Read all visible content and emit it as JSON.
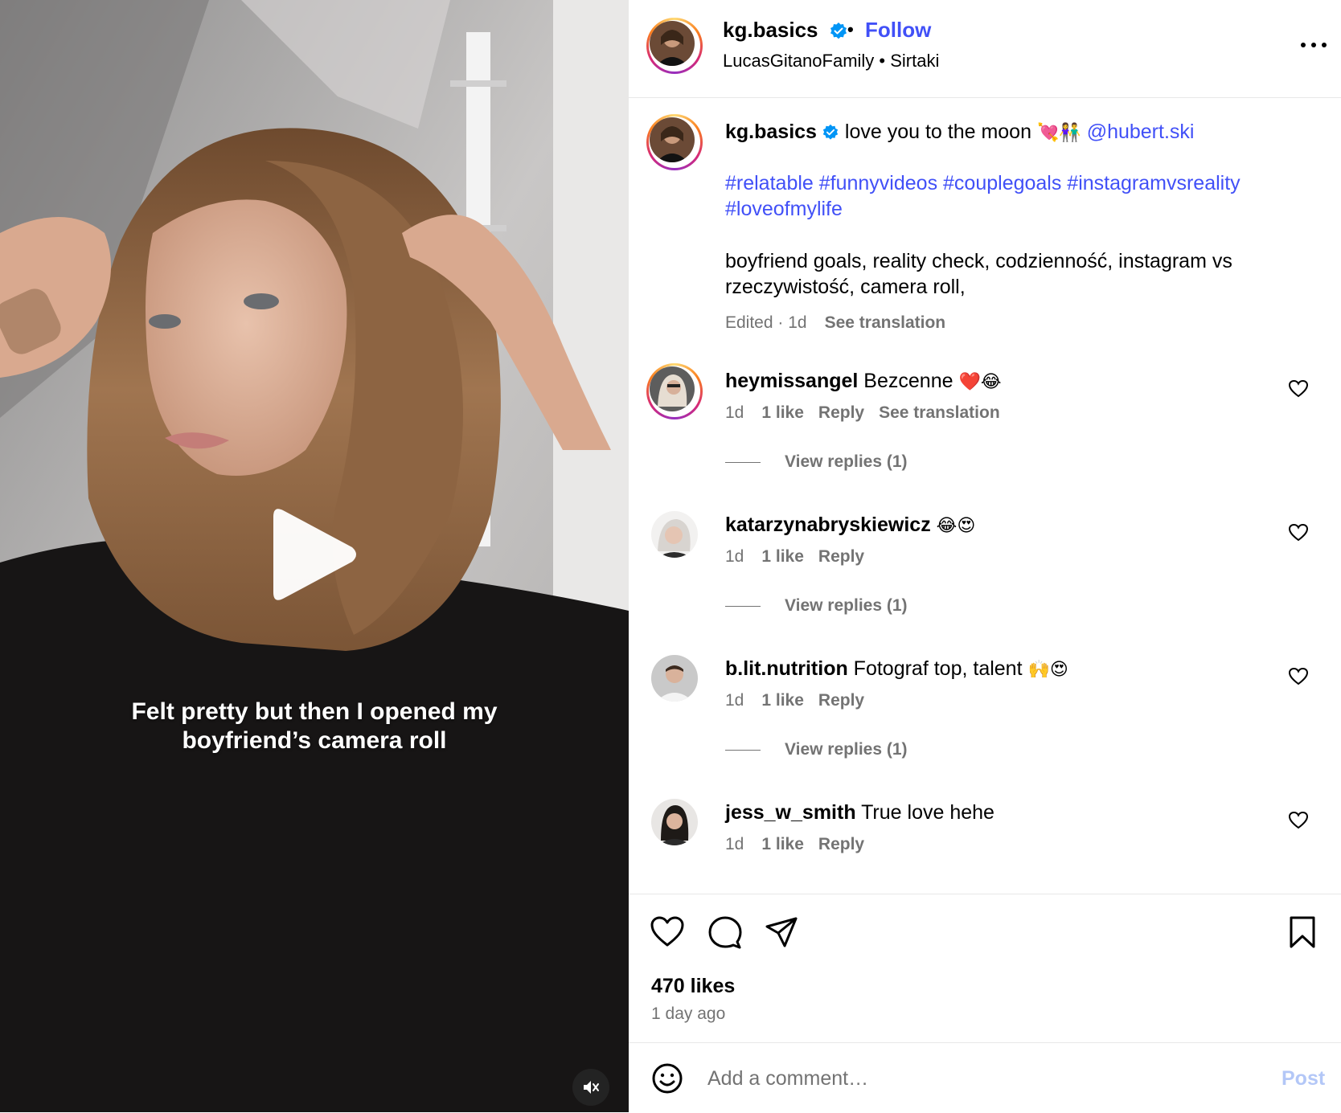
{
  "video": {
    "overlay_line1": "Felt pretty but then I opened my",
    "overlay_line2": "boyfriend’s camera roll",
    "play_icon": "play-icon",
    "mute_icon": "speaker-muted-icon"
  },
  "header": {
    "username": "kg.basics",
    "separator": "•",
    "follow_label": "Follow",
    "subtitle": "LucasGitanoFamily • Sirtaki",
    "more_icon": "more-horizontal-icon"
  },
  "caption": {
    "username": "kg.basics",
    "text": " love you to the moon ",
    "emoji": "💘👫",
    "mention": "@hubert.ski",
    "hashtags_line1": "#relatable #funnyvideos #couplegoals #instagramvsreality",
    "hashtags_line2": "#loveofmylife",
    "keywords": "boyfriend goals, reality check, codzienność, instagram vs rzeczywistość, camera roll,",
    "edited": "Edited · 1d",
    "see_translation": "See translation"
  },
  "comments": [
    {
      "username": "heymissangel",
      "text": " Bezcenne ",
      "emoji": "❤️😂",
      "time": "1d",
      "likes": "1 like",
      "reply": "Reply",
      "translate": "See translation",
      "view_replies": "View replies (1)"
    },
    {
      "username": "katarzynabryskiewicz",
      "text": " ",
      "emoji": "😂😍",
      "time": "1d",
      "likes": "1 like",
      "reply": "Reply",
      "view_replies": "View replies (1)"
    },
    {
      "username": "b.lit.nutrition",
      "text": " Fotograf top, talent ",
      "emoji": "🙌😍",
      "time": "1d",
      "likes": "1 like",
      "reply": "Reply",
      "view_replies": "View replies (1)"
    },
    {
      "username": "jess_w_smith",
      "text": " True love hehe",
      "emoji": "",
      "time": "1d",
      "likes": "1 like",
      "reply": "Reply"
    }
  ],
  "actions": {
    "likes": "470 likes",
    "time_ago": "1 day ago",
    "icons": [
      "heart-icon",
      "comment-icon",
      "share-icon",
      "bookmark-icon"
    ]
  },
  "composer": {
    "placeholder": "Add a comment…",
    "post_label": "Post"
  },
  "colors": {
    "link": "#4150f7",
    "muted": "#737373",
    "post_disabled": "#b3c7f7"
  }
}
